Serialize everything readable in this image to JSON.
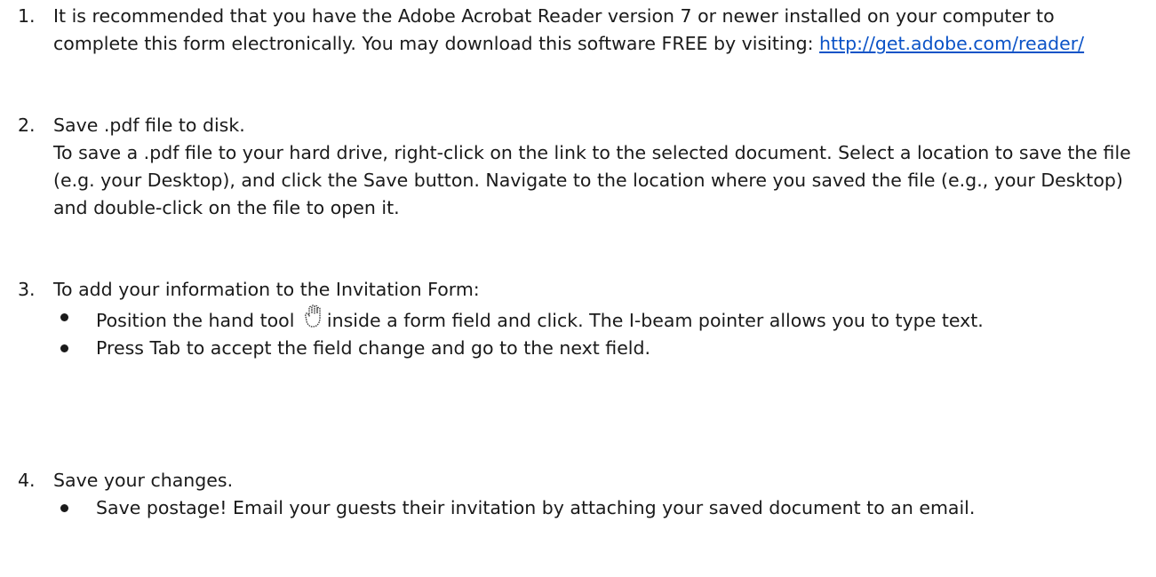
{
  "instructions": [
    {
      "number": "1.",
      "text": "It is recommended that you have the Adobe Acrobat Reader version 7 or newer installed on your computer to complete this form electronically. You may download this software FREE by visiting: ",
      "link": "http://get.adobe.com/reader/"
    },
    {
      "number": "2.",
      "heading": "Save .pdf file to disk.",
      "text": "To save a .pdf file to your hard drive, right-click on the link to the selected document. Select a location to save the file (e.g. your Desktop), and click the Save button. Navigate to the location where you saved the file (e.g., your Desktop) and double-click on the file to open it."
    },
    {
      "number": "3.",
      "heading": "To add your information to the Invitation Form:",
      "bullets": [
        {
          "before": "Position the hand tool ",
          "icon": "hand-tool-icon",
          "after": "inside a form field and click. The I-beam pointer allows you to type text."
        },
        {
          "text": "Press Tab to accept the field change and go to the next field."
        }
      ]
    },
    {
      "number": "4.",
      "heading": "Save your changes.",
      "bullets": [
        {
          "text": "Save postage! Email your guests their invitation by attaching your saved document to an email."
        }
      ]
    }
  ]
}
